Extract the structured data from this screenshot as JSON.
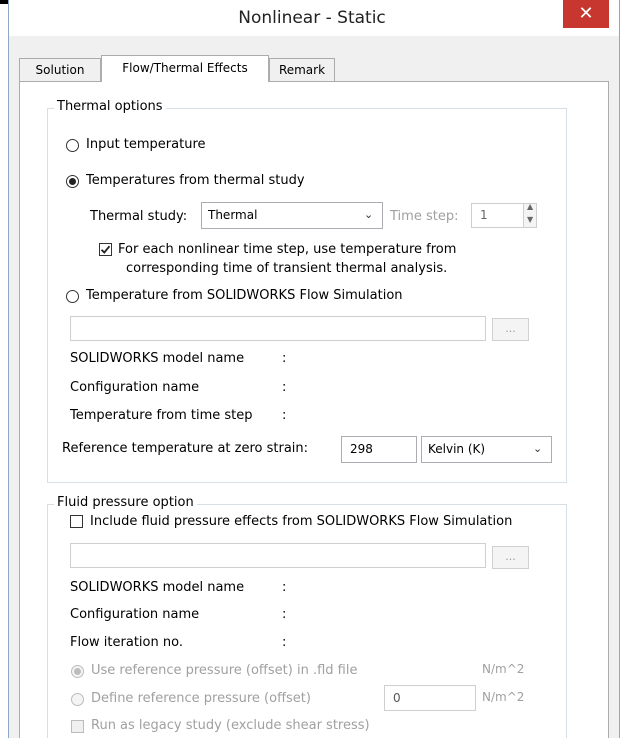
{
  "window": {
    "title": "Nonlinear - Static",
    "close_glyph": "✕"
  },
  "tabs": [
    {
      "label": "Solution",
      "active": false
    },
    {
      "label": "Flow/Thermal Effects",
      "active": true
    },
    {
      "label": "Remark",
      "active": false
    }
  ],
  "thermal": {
    "legend": "Thermal options",
    "input_temperature": "Input temperature",
    "from_thermal_study": "Temperatures from thermal study",
    "selected_option": "from_thermal_study",
    "thermal_study_label": "Thermal study:",
    "thermal_study_value": "Thermal",
    "time_step_label": "Time step:",
    "time_step_value": "1",
    "transient_line1": "For each nonlinear time step, use temperature from",
    "transient_line2": "corresponding time of transient thermal analysis.",
    "transient_checked": true,
    "from_flow": "Temperature from SOLIDWORKS Flow Simulation",
    "flow_file_value": "",
    "browse_label": "...",
    "model_name_label": "SOLIDWORKS model name",
    "config_name_label": "Configuration name",
    "time_step_from_label": "Temperature from time step",
    "colon": ":",
    "ref_temp_label": "Reference temperature at zero strain:",
    "ref_temp_value": "298",
    "unit_value": "Kelvin (K)"
  },
  "fluid": {
    "legend": "Fluid pressure option",
    "include_label": "Include fluid pressure effects from SOLIDWORKS Flow Simulation",
    "include_checked": false,
    "file_value": "",
    "browse_label": "...",
    "model_name_label": "SOLIDWORKS model name",
    "config_name_label": "Configuration name",
    "iteration_label": "Flow iteration no.",
    "colon": ":",
    "use_ref_label": "Use reference pressure (offset) in .fld file",
    "define_ref_label": "Define reference pressure (offset)",
    "ref_value": "0",
    "unit_label": "N/m^2",
    "legacy_label": "Run as legacy study (exclude shear stress)"
  },
  "colors": {
    "close": "#c7372f",
    "group_border": "#d5dfe5",
    "disabled_text": "#a0a0a0"
  }
}
